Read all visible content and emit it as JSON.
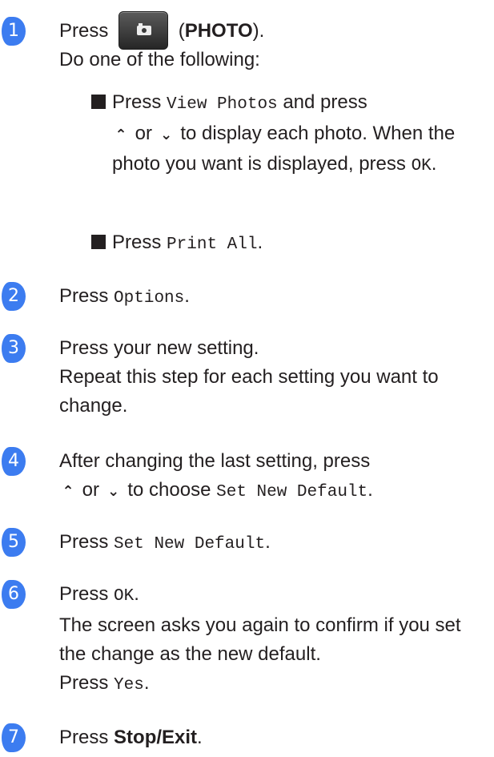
{
  "accent_color": "#3c7cf0",
  "steps": [
    {
      "number": "1",
      "press": "Press",
      "photo_icon": "camera-icon",
      "photo_open": "(",
      "photo_label": "PHOTO",
      "photo_close": ").",
      "line2": "Do one of the following:",
      "bullets": [
        {
          "p1": "Press",
          "b1": "View Photos",
          "p2": "and press",
          "up": "⌃",
          "or": "or",
          "down": "⌄",
          "p3": "to display each photo. When the photo you want is displayed, press",
          "b2": "OK",
          "end": "."
        },
        {
          "p1": "Press",
          "b1": "Print All",
          "end": "."
        }
      ]
    },
    {
      "number": "2",
      "press": "Press",
      "btn": "Options",
      "end": "."
    },
    {
      "number": "3",
      "text1": "Press your new setting.",
      "text2": "Repeat this step for each setting you want to change."
    },
    {
      "number": "4",
      "text1": "After changing the last setting, press",
      "up": "⌃",
      "or": "or",
      "down": "⌄",
      "text2": "to choose",
      "btn": "Set New Default",
      "end": "."
    },
    {
      "number": "5",
      "press": "Press",
      "btn": "Set New Default",
      "end": "."
    },
    {
      "number": "6",
      "press": "Press",
      "btn": "OK",
      "end": ".",
      "text2": "The screen asks you again to confirm if you set the change as the new default.",
      "press2": "Press",
      "btn2": "Yes",
      "end2": "."
    },
    {
      "number": "7",
      "press": "Press",
      "bold": "Stop/Exit",
      "end": "."
    }
  ]
}
